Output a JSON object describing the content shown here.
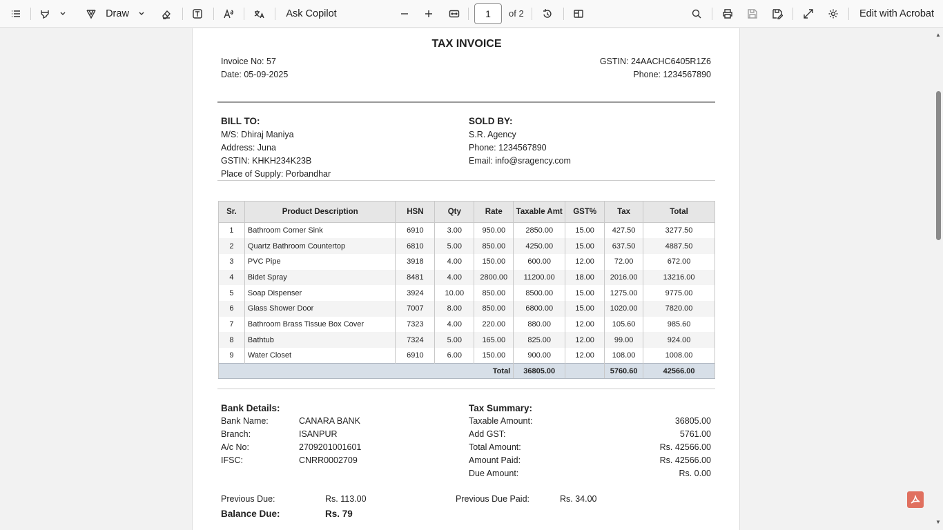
{
  "toolbar": {
    "draw_label": "Draw",
    "ask_copilot_label": "Ask Copilot",
    "page_current": "1",
    "page_of": "of 2",
    "edit_label": "Edit with Acrobat"
  },
  "invoice": {
    "title": "TAX INVOICE",
    "invoice_no": "Invoice No: 57",
    "date": "Date: 05-09-2025",
    "gstin": "GSTIN: 24AACHC6405R1Z6",
    "phone": "Phone: 1234567890"
  },
  "bill_to": {
    "heading": "BILL TO:",
    "name": "M/S: Dhiraj Maniya",
    "address": "Address: Juna",
    "gstin": "GSTIN: KHKH234K23B",
    "place": "Place of Supply: Porbandhar"
  },
  "sold_by": {
    "heading": "SOLD BY:",
    "name": "S.R. Agency",
    "phone": "Phone: 1234567890",
    "email": "Email: info@sragency.com"
  },
  "table": {
    "headers": [
      "Sr.",
      "Product Description",
      "HSN",
      "Qty",
      "Rate",
      "Taxable Amt",
      "GST%",
      "Tax",
      "Total"
    ],
    "rows": [
      [
        "1",
        "Bathroom Corner Sink",
        "6910",
        "3.00",
        "950.00",
        "2850.00",
        "15.00",
        "427.50",
        "3277.50"
      ],
      [
        "2",
        "Quartz Bathroom Countertop",
        "6810",
        "5.00",
        "850.00",
        "4250.00",
        "15.00",
        "637.50",
        "4887.50"
      ],
      [
        "3",
        "PVC Pipe",
        "3918",
        "4.00",
        "150.00",
        "600.00",
        "12.00",
        "72.00",
        "672.00"
      ],
      [
        "4",
        "Bidet Spray",
        "8481",
        "4.00",
        "2800.00",
        "11200.00",
        "18.00",
        "2016.00",
        "13216.00"
      ],
      [
        "5",
        "Soap Dispenser",
        "3924",
        "10.00",
        "850.00",
        "8500.00",
        "15.00",
        "1275.00",
        "9775.00"
      ],
      [
        "6",
        "Glass Shower Door",
        "7007",
        "8.00",
        "850.00",
        "6800.00",
        "15.00",
        "1020.00",
        "7820.00"
      ],
      [
        "7",
        "Bathroom Brass Tissue Box Cover",
        "7323",
        "4.00",
        "220.00",
        "880.00",
        "12.00",
        "105.60",
        "985.60"
      ],
      [
        "8",
        "Bathtub",
        "7324",
        "5.00",
        "165.00",
        "825.00",
        "12.00",
        "99.00",
        "924.00"
      ],
      [
        "9",
        "Water Closet",
        "6910",
        "6.00",
        "150.00",
        "900.00",
        "12.00",
        "108.00",
        "1008.00"
      ]
    ],
    "total": {
      "label": "Total",
      "taxable": "36805.00",
      "tax": "5760.60",
      "grand": "42566.00"
    }
  },
  "bank": {
    "heading": "Bank Details:",
    "rows": [
      {
        "label": "Bank Name:",
        "value": "CANARA BANK"
      },
      {
        "label": "Branch:",
        "value": "ISANPUR"
      },
      {
        "label": "A/c No:",
        "value": "2709201001601"
      },
      {
        "label": "IFSC:",
        "value": "CNRR0002709"
      }
    ]
  },
  "tax_summary": {
    "heading": "Tax Summary:",
    "rows": [
      {
        "label": "Taxable Amount:",
        "value": "36805.00"
      },
      {
        "label": "Add GST:",
        "value": "5761.00"
      },
      {
        "label": "Total Amount:",
        "value": "Rs. 42566.00"
      },
      {
        "label": "Amount Paid:",
        "value": "Rs. 42566.00"
      },
      {
        "label": "Due Amount:",
        "value": "Rs. 0.00"
      }
    ]
  },
  "dues": {
    "prev_due_label": "Previous Due:",
    "prev_due_value": "Rs. 113.00",
    "prev_paid_label": "Previous Due Paid:",
    "prev_paid_value": "Rs. 34.00",
    "balance_label": "Balance Due:",
    "balance_value": "Rs. 79"
  }
}
